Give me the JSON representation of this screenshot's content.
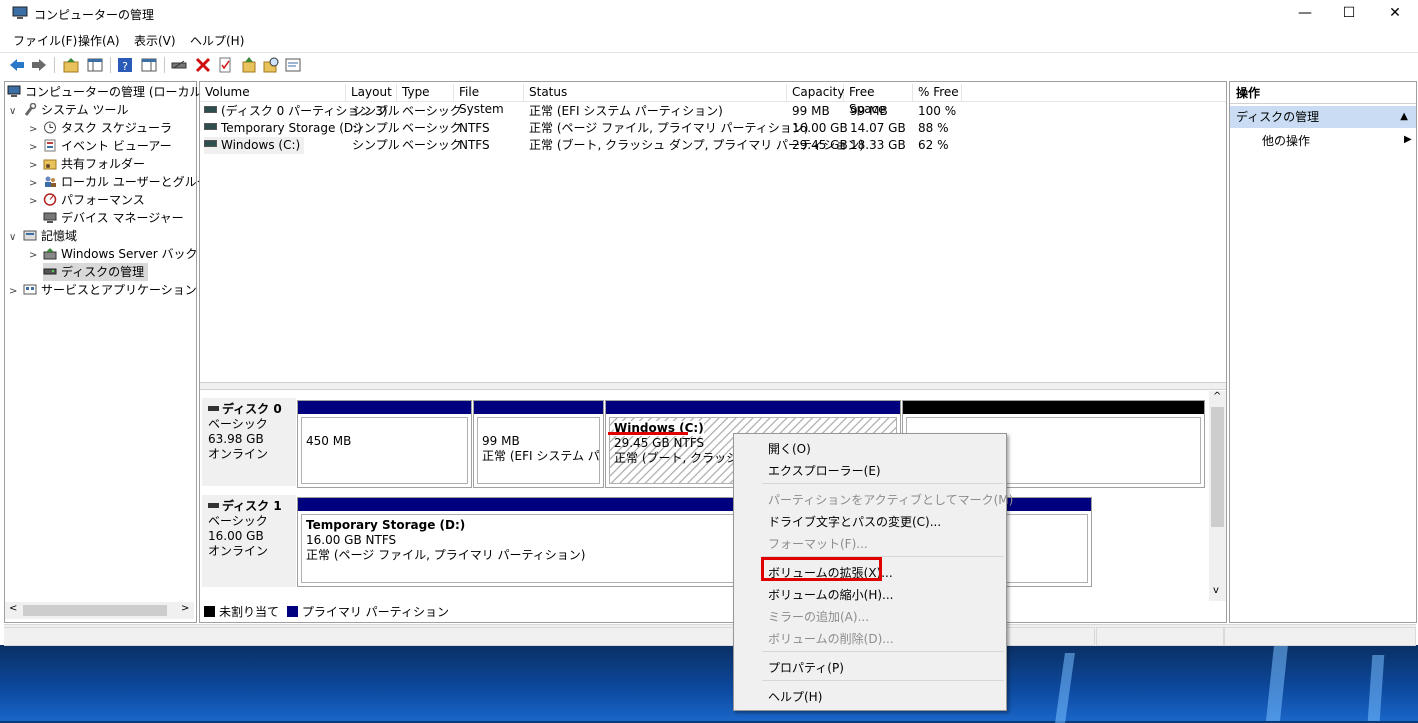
{
  "window": {
    "title": "コンピューターの管理"
  },
  "window_controls": {
    "minimize": "—",
    "maximize": "☐",
    "close": "✕"
  },
  "menu": [
    "ファイル(F)",
    "操作(A)",
    "表示(V)",
    "ヘルプ(H)"
  ],
  "tree": {
    "items": [
      {
        "label": "コンピューターの管理 (ローカル)",
        "icon": "computer-icon",
        "arrow": ""
      },
      {
        "label": "システム ツール",
        "icon": "tools-icon",
        "arrow": "∨"
      },
      {
        "label": "タスク スケジューラ",
        "icon": "clock-icon",
        "arrow": ">"
      },
      {
        "label": "イベント ビューアー",
        "icon": "event-viewer-icon",
        "arrow": ">"
      },
      {
        "label": "共有フォルダー",
        "icon": "shared-folder-icon",
        "arrow": ">"
      },
      {
        "label": "ローカル ユーザーとグループ",
        "icon": "users-icon",
        "arrow": ">"
      },
      {
        "label": "パフォーマンス",
        "icon": "performance-icon",
        "arrow": ">"
      },
      {
        "label": "デバイス マネージャー",
        "icon": "device-manager-icon",
        "arrow": ""
      },
      {
        "label": "記憶域",
        "icon": "storage-icon",
        "arrow": "∨"
      },
      {
        "label": "Windows Server バックア",
        "icon": "backup-icon",
        "arrow": ">"
      },
      {
        "label": "ディスクの管理",
        "icon": "disk-icon",
        "arrow": ""
      },
      {
        "label": "サービスとアプリケーション",
        "icon": "services-icon",
        "arrow": ">"
      }
    ]
  },
  "volume_list": {
    "columns": [
      "Volume",
      "Layout",
      "Type",
      "File System",
      "Status",
      "Capacity",
      "Free Space",
      "% Free"
    ],
    "rows": [
      [
        "(ディスク 0 パーティション 3)",
        "シンプル",
        "ベーシック",
        "",
        "正常 (EFI システム パーティション)",
        "99 MB",
        "99 MB",
        "100 %"
      ],
      [
        "Temporary Storage (D:)",
        "シンプル",
        "ベーシック",
        "NTFS",
        "正常 (ページ ファイル, プライマリ パーティション)",
        "16.00 GB",
        "14.07 GB",
        "88 %"
      ],
      [
        "Windows (C:)",
        "シンプル",
        "ベーシック",
        "NTFS",
        "正常 (ブート, クラッシュ ダンプ, プライマリ パーティション)",
        "29.45 GB",
        "18.33 GB",
        "62 %"
      ]
    ]
  },
  "disks": [
    {
      "name": "ディスク 0",
      "type": "ベーシック",
      "size": "63.98 GB",
      "state": "オンライン",
      "partitions": [
        {
          "line1": "450 MB",
          "line2": ""
        },
        {
          "line1": "99 MB",
          "line2": "正常 (EFI システム パーテ"
        },
        {
          "title": "Windows  (C:)",
          "line1": "29.45 GB NTFS",
          "line2": "正常 (ブート, クラッシュ ダン"
        }
      ]
    },
    {
      "name": "ディスク 1",
      "type": "ベーシック",
      "size": "16.00 GB",
      "state": "オンライン",
      "partitions": [
        {
          "title": "Temporary Storage  (D:)",
          "line1": "16.00 GB NTFS",
          "line2": "正常 (ページ ファイル, プライマリ パーティション)"
        }
      ]
    }
  ],
  "legend": {
    "unallocated": "未割り当て",
    "primary": "プライマリ パーティション"
  },
  "actions": {
    "header": "操作",
    "section": "ディスクの管理",
    "more": "他の操作"
  },
  "context_menu": [
    {
      "label": "開く(O)",
      "enabled": true
    },
    {
      "label": "エクスプローラー(E)",
      "enabled": true
    },
    {
      "label": "パーティションをアクティブとしてマーク(M)",
      "enabled": false
    },
    {
      "label": "ドライブ文字とパスの変更(C)...",
      "enabled": true
    },
    {
      "label": "フォーマット(F)...",
      "enabled": false
    },
    {
      "label": "ボリュームの拡張(X)...",
      "enabled": true
    },
    {
      "label": "ボリュームの縮小(H)...",
      "enabled": true
    },
    {
      "label": "ミラーの追加(A)...",
      "enabled": false
    },
    {
      "label": "ボリュームの削除(D)...",
      "enabled": false
    },
    {
      "label": "プロパティ(P)",
      "enabled": true
    },
    {
      "label": "ヘルプ(H)",
      "enabled": true
    }
  ],
  "colors": {
    "primary_partition": "#00007f",
    "unallocated": "#000000",
    "highlight": "#e00000"
  }
}
